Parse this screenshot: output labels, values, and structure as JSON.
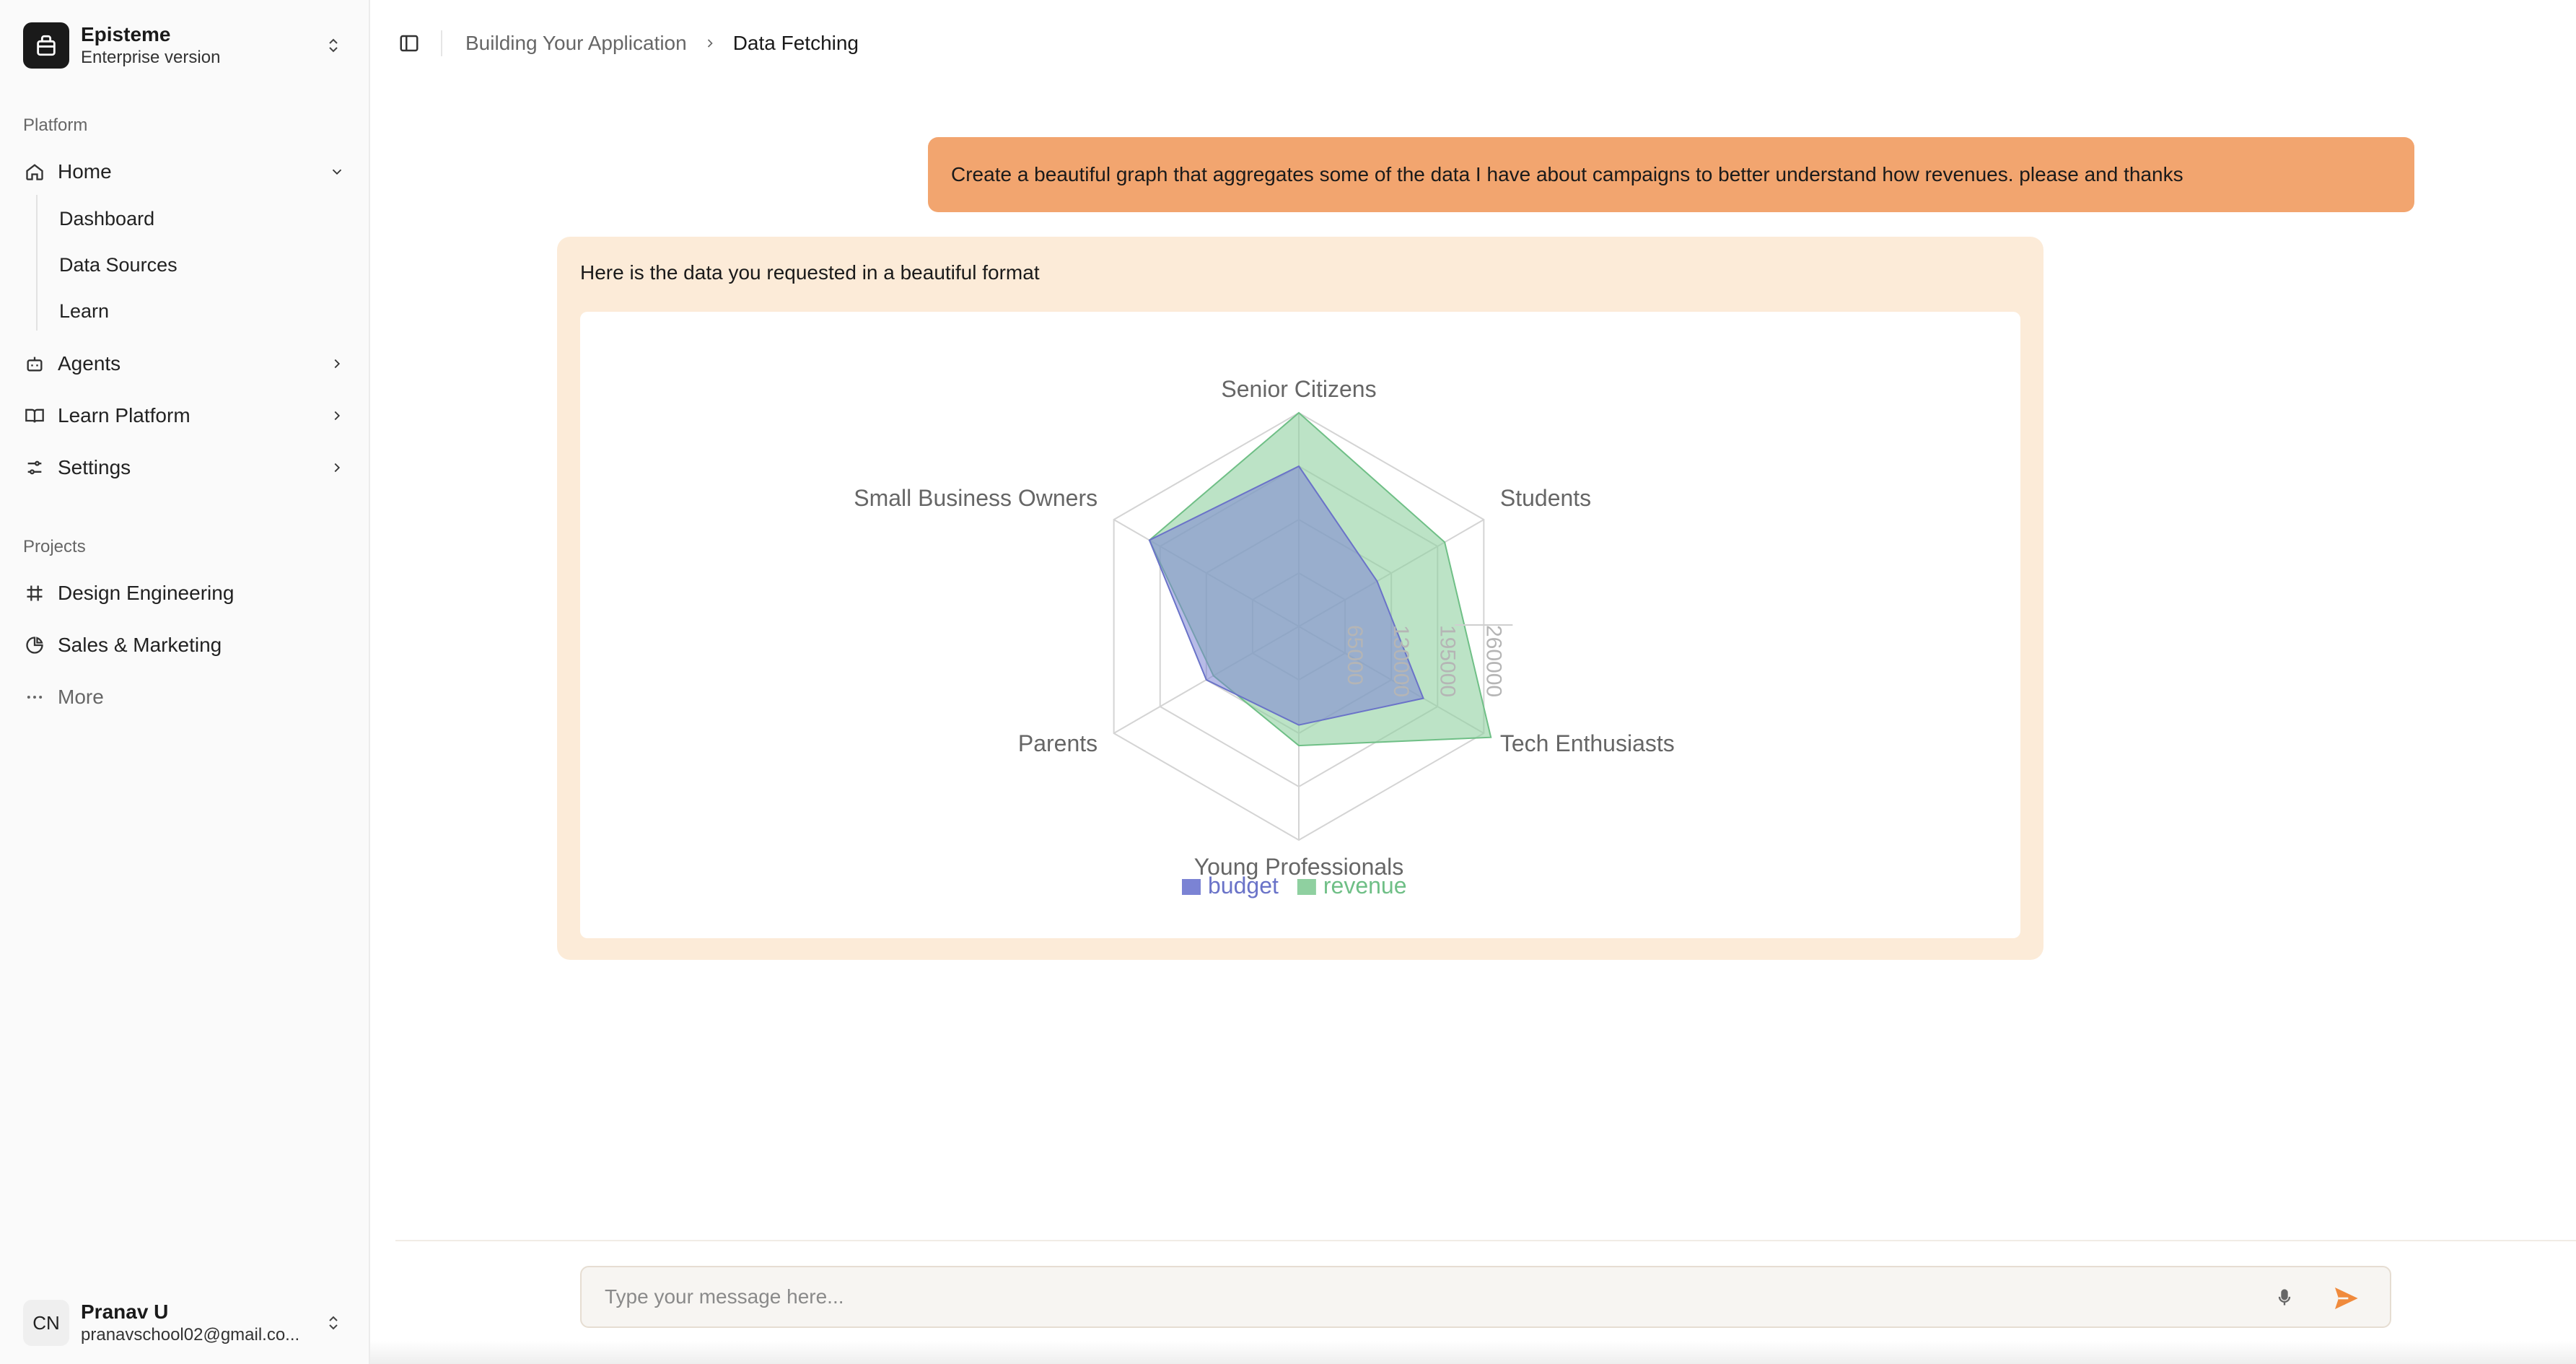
{
  "org": {
    "name": "Episteme",
    "plan": "Enterprise version"
  },
  "sidebar": {
    "platform_label": "Platform",
    "home": {
      "label": "Home",
      "children": [
        "Dashboard",
        "Data Sources",
        "Learn"
      ]
    },
    "items": [
      {
        "label": "Agents",
        "icon": "bot-icon"
      },
      {
        "label": "Learn Platform",
        "icon": "book-icon"
      },
      {
        "label": "Settings",
        "icon": "sliders-icon"
      }
    ],
    "projects_label": "Projects",
    "projects": [
      {
        "label": "Design Engineering",
        "icon": "frame-icon"
      },
      {
        "label": "Sales & Marketing",
        "icon": "pie-chart-icon"
      }
    ],
    "more_label": "More"
  },
  "user": {
    "initials": "CN",
    "name": "Pranav U",
    "email": "pranavschool02@gmail.co..."
  },
  "breadcrumb": {
    "parent": "Building Your Application",
    "current": "Data Fetching"
  },
  "chat": {
    "user_message": "Create a beautiful graph that aggregates some of the data I have about campaigns to better understand how revenues. please and thanks",
    "bot_message": "Here is the data you requested in a beautiful format"
  },
  "composer": {
    "placeholder": "Type your message here..."
  },
  "colors": {
    "user_bubble": "#f2a56f",
    "bot_bubble": "#fcebd8",
    "budget": "#7b83d4",
    "revenue": "#8fd0a0",
    "send": "#f08a3c"
  },
  "chart_data": {
    "type": "radar",
    "categories": [
      "Senior Citizens",
      "Students",
      "Tech Enthusiasts",
      "Young Professionals",
      "Parents",
      "Small Business Owners"
    ],
    "ticks": [
      65000,
      130000,
      195000,
      260000
    ],
    "tick_labels": [
      "65000",
      "130000",
      "195000",
      "260000"
    ],
    "rmax": 260000,
    "series": [
      {
        "name": "budget",
        "values": [
          195000,
          110000,
          175000,
          120000,
          130000,
          210000
        ]
      },
      {
        "name": "revenue",
        "values": [
          260000,
          205000,
          270000,
          145000,
          120000,
          210000
        ]
      }
    ],
    "legend": "bottom"
  }
}
